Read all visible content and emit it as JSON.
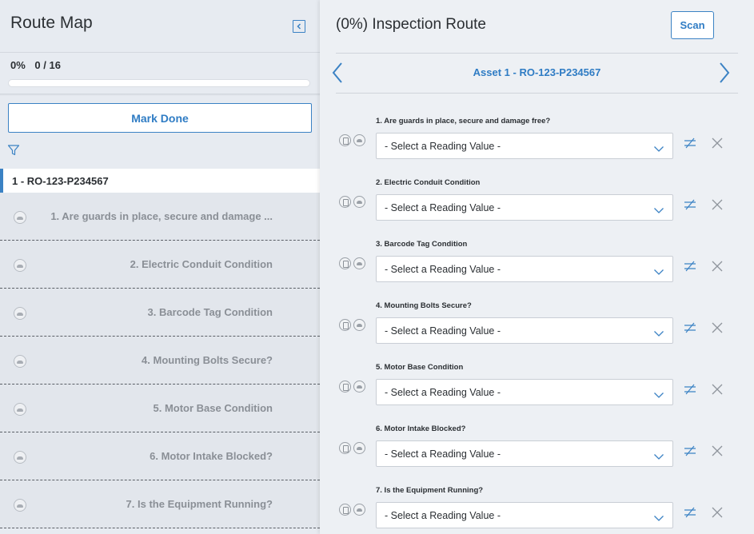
{
  "left": {
    "title": "Route Map",
    "progress_percent": "0%",
    "progress_count": "0 / 16",
    "progress_fraction": 0,
    "mark_done_label": "Mark Done",
    "asset_label": "1 - RO-123-P234567",
    "questions": [
      "1. Are guards in place, secure and damage ...",
      "2. Electric Conduit Condition",
      "3. Barcode Tag Condition",
      "4. Mounting Bolts Secure?",
      "5. Motor Base Condition",
      "6. Motor Intake Blocked?",
      "7. Is the Equipment Running?"
    ]
  },
  "right": {
    "title": "(0%) Inspection Route",
    "scan_label": "Scan",
    "asset_name": "Asset 1 - RO-123-P234567",
    "select_placeholder": "- Select a Reading Value -",
    "last_select_partial": "- Select a Reading Value -",
    "questions": [
      "1. Are guards in place, secure and damage free?",
      "2. Electric Conduit Condition",
      "3. Barcode Tag Condition",
      "4. Mounting Bolts Secure?",
      "5. Motor Base Condition",
      "6. Motor Intake Blocked?",
      "7. Is the Equipment Running?"
    ]
  },
  "colors": {
    "accent": "#3b82c4",
    "left_bg": "#e7ebf1",
    "right_bg": "#edf0f4"
  },
  "icons": {
    "collapse": "collapse-panel-icon",
    "filter": "filter-icon",
    "prev": "chevron-left-icon",
    "next": "chevron-right-icon",
    "adjust": "adjust-icon",
    "close": "close-icon",
    "cloud": "cloud-icon",
    "phone": "phone-icon"
  }
}
